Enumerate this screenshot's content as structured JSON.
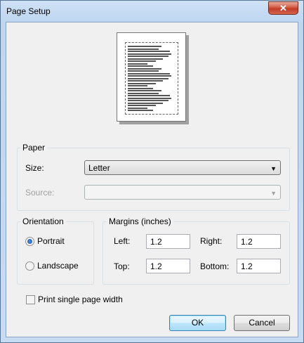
{
  "window": {
    "title": "Page Setup",
    "close_glyph": "✕",
    "close_icon": "close-icon"
  },
  "preview": {
    "icon": "page-preview"
  },
  "paper": {
    "group_label": "Paper",
    "size_label": "Size:",
    "size_value": "Letter",
    "source_label": "Source:",
    "source_value": "",
    "dropdown_glyph": "▼"
  },
  "orientation": {
    "group_label": "Orientation",
    "portrait_label": "Portrait",
    "landscape_label": "Landscape",
    "selected": "Portrait"
  },
  "margins": {
    "group_label": "Margins (inches)",
    "left_label": "Left:",
    "left_value": "1.2",
    "right_label": "Right:",
    "right_value": "1.2",
    "top_label": "Top:",
    "top_value": "1.2",
    "bottom_label": "Bottom:",
    "bottom_value": "1.2"
  },
  "options": {
    "single_page_width_label": "Print single page width",
    "single_page_width_checked": false
  },
  "buttons": {
    "ok_label": "OK",
    "cancel_label": "Cancel"
  },
  "colors": {
    "title_bar": "#bed6f0",
    "close_button": "#c13b25",
    "default_button_border": "#3c7fb1"
  }
}
